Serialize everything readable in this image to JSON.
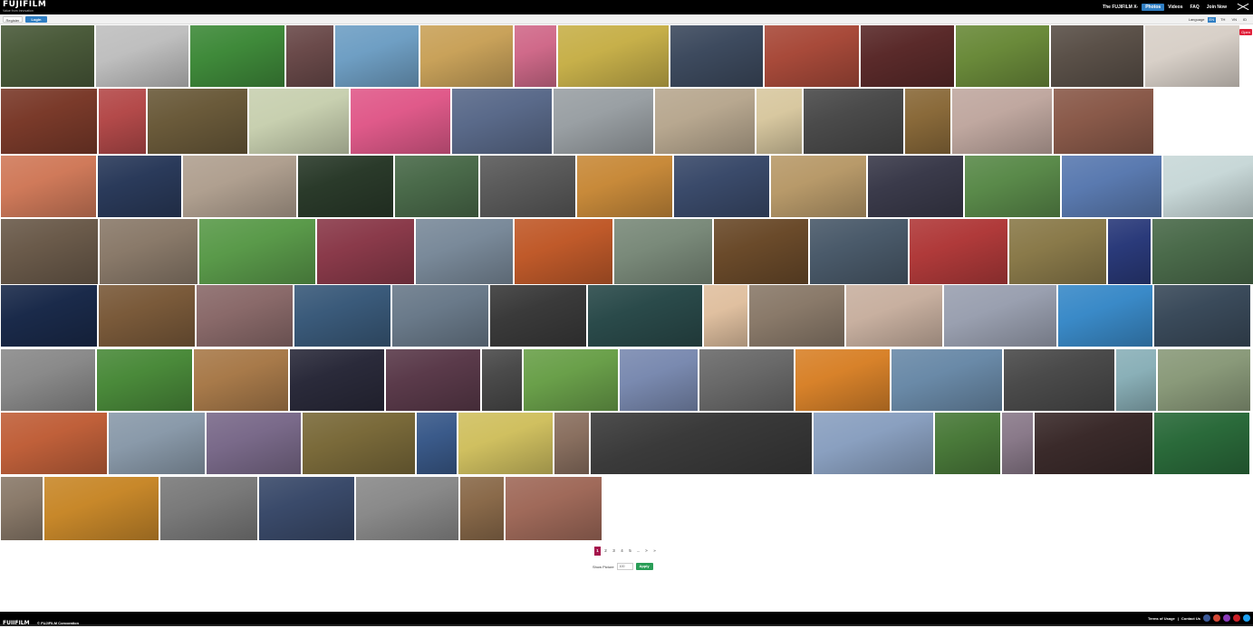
{
  "header": {
    "brand": "FUJIFILM",
    "tagline": "Value from Innovation",
    "nav": [
      {
        "label": "The FUJIFILM X-",
        "active": false
      },
      {
        "label": "Photos",
        "active": true
      },
      {
        "label": "Videos",
        "active": false
      },
      {
        "label": "FAQ",
        "active": false
      },
      {
        "label": "Join Now",
        "active": false
      }
    ]
  },
  "subbar": {
    "register_label": "Register",
    "login_label": "Login",
    "language_label": "Language",
    "languages": [
      {
        "code": "EN",
        "active": true
      },
      {
        "code": "TH",
        "active": false
      },
      {
        "code": "VN",
        "active": false
      },
      {
        "code": "ID",
        "active": false
      }
    ]
  },
  "gallery": {
    "open_badge": "Open",
    "tile_colors": [
      "#4a5a3a",
      "#bfbfbf",
      "#3f8a3a",
      "#6a4a4a",
      "#6f9fc4",
      "#c9a25a",
      "#d06a8a",
      "#c7b04a",
      "#3d4a5e",
      "#a84a3a",
      "#5a2a2a",
      "#6a8a3a",
      "#5a5048",
      "#d8d0c8",
      "#7a3a2a",
      "#b44a4a",
      "#6a5a3a",
      "#c8d0b0",
      "#e05a8a",
      "#5a6a8a",
      "#9aa0a4",
      "#b8a890",
      "#d8c8a0",
      "#4a4a4a",
      "#8a6a3a",
      "#c0a8a0",
      "#8a5a4a",
      "#d07a5a",
      "#2a3a5a",
      "#b0a090",
      "#2a3a2a",
      "#4a6a4a",
      "#5a5a5a",
      "#c88a3a",
      "#3a4a6a",
      "#b89a6a",
      "#3a3a4a",
      "#5a8a4a",
      "#5a7ab0",
      "#c8d8d8",
      "#6a5a4a",
      "#8a7a6a",
      "#5a9a4a",
      "#8a3a4a",
      "#7a8a9a",
      "#c05a2a",
      "#7a8a7a",
      "#6a4a2a",
      "#4a5a6a",
      "#b03a3a",
      "#8a7a4a",
      "#2a3a7a",
      "#4a6a4a",
      "#1a2a4a",
      "#7a5a3a",
      "#8a6a6a",
      "#3a5a7a",
      "#6a7a8a",
      "#3a3a3a",
      "#2a4a4a",
      "#e0c0a0",
      "#8a7a6a",
      "#c8b0a0",
      "#9aa0b0",
      "#3a8ac8",
      "#3a4a5a",
      "#8a8a8a",
      "#4a8a3a",
      "#a87a4a",
      "#2a2a3a",
      "#5a3a4a",
      "#4a4a4a",
      "#6aa04a",
      "#7a8ab0",
      "#6a6a6a",
      "#d8822a",
      "#6a8aa8",
      "#4a4a4a",
      "#8ab0b8",
      "#8a9a7a",
      "#c0603a",
      "#8a9aaa",
      "#7a6a8a",
      "#7a6a3a",
      "#3a5a8a",
      "#d0c060",
      "#8a7060",
      "#3a3a3a",
      "#8aa0c0",
      "#4a7a3a",
      "#8a7a8a",
      "#3a2a2a",
      "#2a6a3a",
      "#8a7a6a",
      "#c8882a",
      "#7a7a7a",
      "#3a4a6a",
      "#8a8a8a",
      "#8a6a4a",
      "#a06a5a"
    ]
  },
  "pagination": {
    "pages": [
      "1",
      "2",
      "3",
      "4",
      "5",
      "...",
      ">",
      "»"
    ],
    "show_label": "Show Picture",
    "count_value": "100",
    "apply_label": "Apply"
  },
  "footer": {
    "brand": "FUJIFILM",
    "copyright": "© FUJIFILM Corporation",
    "terms_label": "Terms of Usage",
    "contact_label": "Contact Us",
    "separator": "|",
    "socials": [
      {
        "name": "facebook-icon",
        "color": "#3b5998"
      },
      {
        "name": "googleplus-icon",
        "color": "#d34836"
      },
      {
        "name": "instagram-icon",
        "color": "#8a3ab9"
      },
      {
        "name": "pinterest-icon",
        "color": "#cb2027"
      },
      {
        "name": "twitter-icon",
        "color": "#1da1f2"
      }
    ]
  }
}
